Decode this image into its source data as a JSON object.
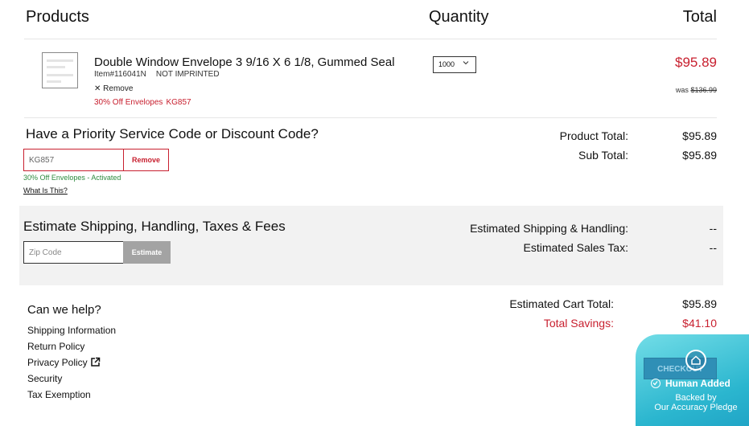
{
  "header": {
    "products": "Products",
    "quantity": "Quantity",
    "total": "Total"
  },
  "item": {
    "name": "Double Window Envelope 3 9/16 X 6 1/8, Gummed Seal",
    "item_number": "Item#116041N",
    "imprint": "NOT IMPRINTED",
    "remove_label": "✕ Remove",
    "promo_text": "30% Off Envelopes",
    "promo_code": "KG857",
    "quantity": "1000",
    "price": "$95.89",
    "was_label": "was",
    "was_price": "$136.99"
  },
  "discount": {
    "title": "Have a Priority Service Code or Discount Code?",
    "code_value": "KG857",
    "remove_button": "Remove",
    "status": "30% Off Envelopes - Activated",
    "help_link": "What Is This?"
  },
  "totals": {
    "product_total_label": "Product Total:",
    "product_total": "$95.89",
    "sub_total_label": "Sub Total:",
    "sub_total": "$95.89",
    "cart_total_label": "Estimated Cart Total:",
    "cart_total": "$95.89",
    "savings_label": "Total Savings:",
    "savings": "$41.10"
  },
  "shipping": {
    "title": "Estimate Shipping, Handling, Taxes & Fees",
    "zip_placeholder": "Zip Code",
    "estimate_button": "Estimate",
    "ship_label": "Estimated Shipping & Handling:",
    "ship_value": "--",
    "tax_label": "Estimated Sales Tax:",
    "tax_value": "--"
  },
  "help": {
    "title": "Can we help?",
    "links": [
      "Shipping Information",
      "Return Policy",
      "Privacy Policy",
      "Security",
      "Tax Exemption"
    ]
  },
  "badge": {
    "checkout": "CHECKOUT",
    "headline": "Human Added",
    "line1": "Backed by",
    "line2": "Our Accuracy Pledge"
  },
  "colors": {
    "accent_red": "#c8202f",
    "success_green": "#2e8b3e",
    "panel_gray": "#f2f2f2",
    "badge_teal": "#2bb6cf"
  }
}
